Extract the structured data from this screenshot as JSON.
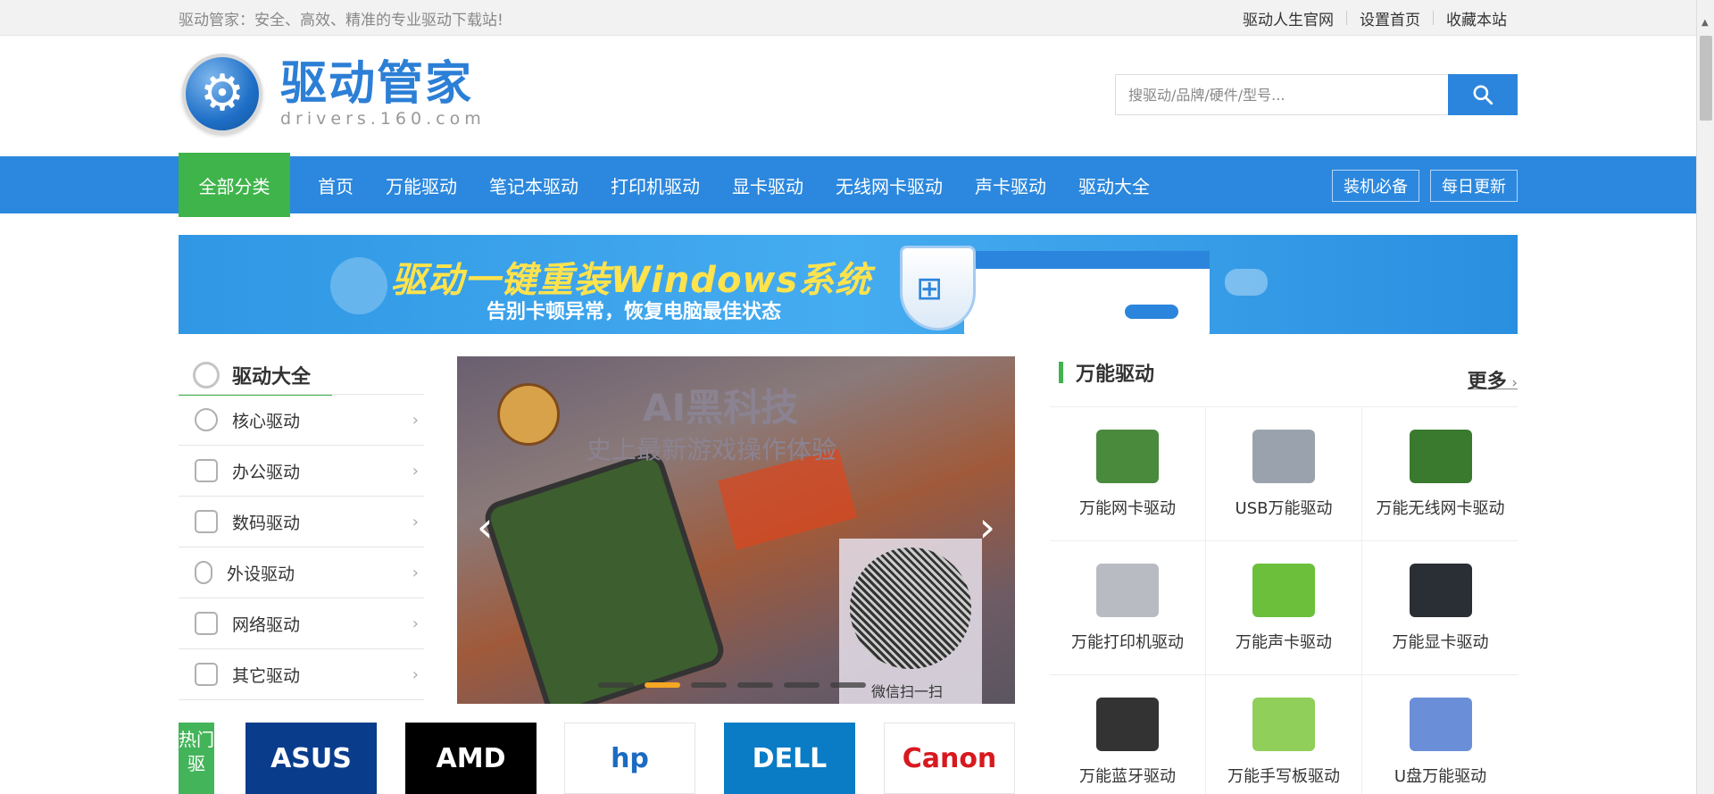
{
  "topbar": {
    "slogan": "驱动管家：安全、高效、精准的专业驱动下载站!",
    "links": [
      "驱动人生官网",
      "设置首页",
      "收藏本站"
    ]
  },
  "header": {
    "logo_cn": "驱动管家",
    "logo_en": "drivers.160.com",
    "search_placeholder": "搜驱动/品牌/硬件/型号..."
  },
  "nav": {
    "all_categories": "全部分类",
    "items": [
      "首页",
      "万能驱动",
      "笔记本驱动",
      "打印机驱动",
      "显卡驱动",
      "无线网卡驱动",
      "声卡驱动",
      "驱动大全"
    ],
    "right_buttons": [
      "装机必备",
      "每日更新"
    ]
  },
  "banner": {
    "title": "驱动一键重装Windows系统",
    "subtitle": "告别卡顿异常，恢复电脑最佳状态"
  },
  "sidebar": {
    "title": "驱动大全",
    "items": [
      {
        "label": "核心驱动",
        "icon": "chip-icon"
      },
      {
        "label": "办公驱动",
        "icon": "printer-icon"
      },
      {
        "label": "数码驱动",
        "icon": "camera-icon"
      },
      {
        "label": "外设驱动",
        "icon": "mouse-icon"
      },
      {
        "label": "网络驱动",
        "icon": "router-icon"
      },
      {
        "label": "其它驱动",
        "icon": "laptop-icon"
      }
    ]
  },
  "carousel": {
    "headline": "AI黑科技",
    "subline": "史上最新游戏操作体验",
    "qr_label": "微信扫一扫",
    "slide_count": 6,
    "active_slide": 2
  },
  "universal": {
    "title": "万能驱动",
    "more": "更多",
    "items": [
      {
        "label": "万能网卡驱动",
        "color": "#4a8a3c"
      },
      {
        "label": "USB万能驱动",
        "color": "#9aa3ad"
      },
      {
        "label": "万能无线网卡驱动",
        "color": "#3a7a2e"
      },
      {
        "label": "万能打印机驱动",
        "color": "#b8bcc2"
      },
      {
        "label": "万能声卡驱动",
        "color": "#6cbf3a"
      },
      {
        "label": "万能显卡驱动",
        "color": "#2a2e35"
      },
      {
        "label": "万能蓝牙驱动",
        "color": "#333333"
      },
      {
        "label": "万能手写板驱动",
        "color": "#8fcf5a"
      },
      {
        "label": "U盘万能驱动",
        "color": "#6a8fd8"
      }
    ]
  },
  "hot": {
    "label": "热门驱",
    "brands": [
      {
        "name": "ASUS",
        "bg": "#0a3c8c",
        "fg": "#ffffff"
      },
      {
        "name": "AMD",
        "bg": "#000000",
        "fg": "#ffffff"
      },
      {
        "name": "hp",
        "bg": "#ffffff",
        "fg": "#1c6bc2"
      },
      {
        "name": "DELL",
        "bg": "#0a7bc5",
        "fg": "#ffffff"
      },
      {
        "name": "Canon",
        "bg": "#ffffff",
        "fg": "#d7191f"
      }
    ]
  },
  "colors": {
    "nav_blue": "#2c88de",
    "accent_green": "#3fb44b",
    "search_blue": "#2c85dc"
  }
}
